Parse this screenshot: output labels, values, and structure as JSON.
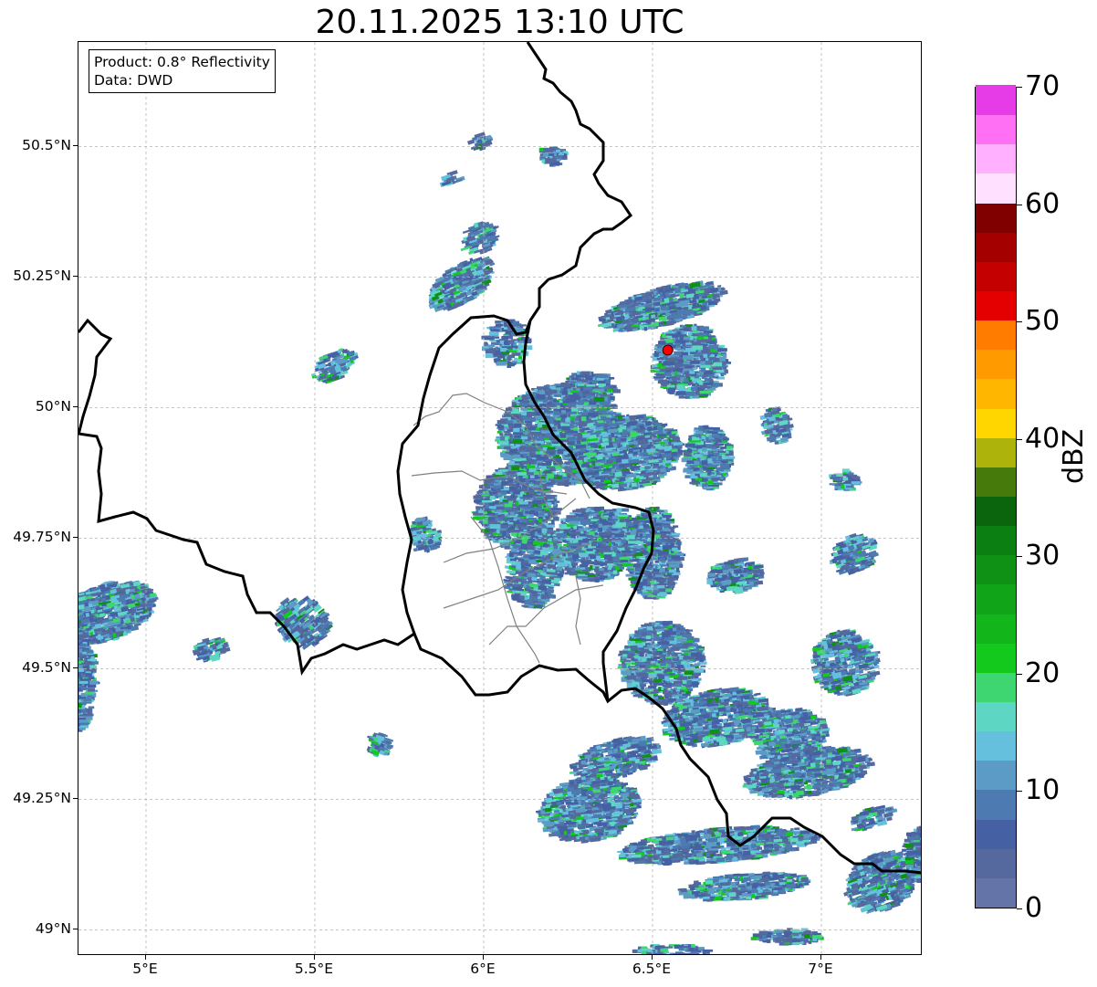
{
  "title": "20.11.2025 13:10 UTC",
  "info": {
    "product": "Product: 0.8° Reflectivity",
    "source": "Data: DWD"
  },
  "axes": {
    "lat_ticks": [
      "50.5°N",
      "50.25°N",
      "50°N",
      "49.75°N",
      "49.5°N",
      "49.25°N",
      "49°N"
    ],
    "lat_values": [
      50.5,
      50.25,
      50.0,
      49.75,
      49.5,
      49.25,
      49.0
    ],
    "lon_ticks": [
      "5°E",
      "5.5°E",
      "6°E",
      "6.5°E",
      "7°E"
    ],
    "lon_values": [
      5.0,
      5.5,
      6.0,
      6.5,
      7.0
    ],
    "lon_range": [
      4.8,
      7.3
    ],
    "lat_range": [
      48.95,
      50.7
    ],
    "grid": true
  },
  "colorbar": {
    "label": "dBZ",
    "ticks": [
      "0",
      "10",
      "20",
      "30",
      "40",
      "50",
      "60",
      "70"
    ],
    "range": [
      0,
      70
    ],
    "colors": [
      "#6474a8",
      "#55699e",
      "#4660a4",
      "#4d7ab0",
      "#5c9bc5",
      "#64c0dc",
      "#5ed6c4",
      "#3ed670",
      "#12c91c",
      "#12b61a",
      "#10a418",
      "#0e9114",
      "#0c7f12",
      "#0a650d",
      "#467a0a",
      "#adb30a",
      "#ffd600",
      "#ffb600",
      "#ff9a00",
      "#ff7c00",
      "#e40000",
      "#c40000",
      "#a40000",
      "#800000",
      "#ffe0ff",
      "#ffb0ff",
      "#ff70f4",
      "#e63ce8"
    ]
  },
  "marker": {
    "label": "radar site",
    "lon": 6.545,
    "lat": 50.11,
    "color": "#ff0000"
  },
  "colors": {
    "border": "#000000",
    "inner_border": "#808080",
    "grid": "#b4b4b4"
  }
}
